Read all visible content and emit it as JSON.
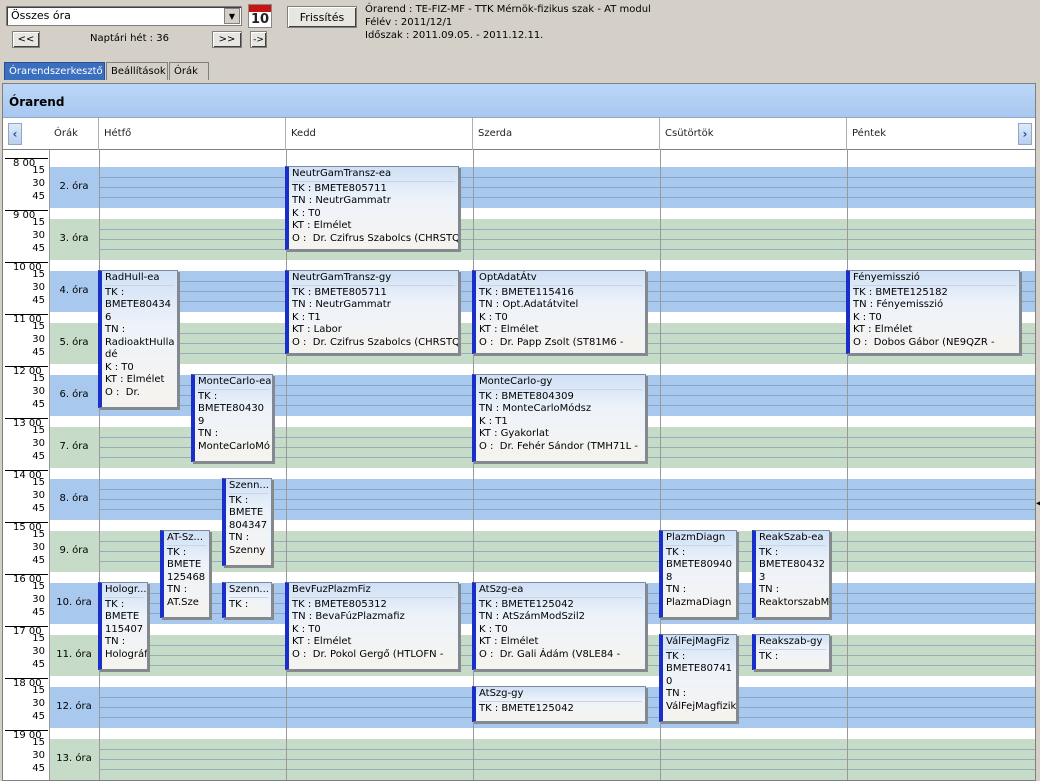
{
  "toolbar": {
    "combo_value": "Összes óra",
    "calendar_day": "10",
    "prev_label": "<<",
    "next_label": ">>",
    "step_label": "->",
    "week_label": "Naptári hét : 36",
    "refresh_label": "Frissítés"
  },
  "info": {
    "line1": "Órarend : TE-FIZ-MF - TTK Mérnök-fizikus szak - AT modul",
    "line2": "Félév : 2011/12/1",
    "line3": "Időszak : 2011.09.05. - 2011.12.11."
  },
  "tabs": [
    "Órarendszerkesztő",
    "Beállítások",
    "Órák"
  ],
  "grid": {
    "title": "Órarend",
    "headers": [
      "Órák",
      "Hétfő",
      "Kedd",
      "Szerda",
      "Csütörtök",
      "Péntek"
    ],
    "hours": [
      "8 00",
      "9 00",
      "10 00",
      "11 00",
      "12 00",
      "13 00",
      "14 00",
      "15 00",
      "16 00",
      "17 00",
      "18 00",
      "19 00"
    ],
    "quarters": [
      "15",
      "30",
      "45"
    ],
    "periods": [
      "2. óra",
      "3. óra",
      "4. óra",
      "5. óra",
      "6. óra",
      "7. óra",
      "8. óra",
      "9. óra",
      "10. óra",
      "11. óra",
      "12. óra",
      "13. óra"
    ]
  },
  "events": [
    {
      "lines": [
        "NeutrGamTransz-ea",
        "TK : BMETE805711",
        "TN : NeutrGammatr",
        "K : T0",
        "KT : Elmélet",
        "O :  Dr. Czifrus Szabolcs (CHRSTQ"
      ]
    },
    {
      "lines": [
        "RadHull-ea",
        "TK :",
        "BMETE80434",
        "6",
        "TN :",
        "RadioaktHulla",
        "dé",
        "K : T0",
        "KT : Elmélet",
        "O :  Dr."
      ]
    },
    {
      "lines": [
        "NeutrGamTransz-gy",
        "TK : BMETE805711",
        "TN : NeutrGammatr",
        "K : T1",
        "KT : Labor",
        "O :  Dr. Czifrus Szabolcs (CHRSTQ"
      ]
    },
    {
      "lines": [
        "OptAdatÁtv",
        "TK : BMETE115416",
        "TN : Opt.Adatátvitel",
        "K : T0",
        "KT : Elmélet",
        "O :  Dr. Papp Zsolt (ST81M6 -"
      ]
    },
    {
      "lines": [
        "Fényemisszió",
        "TK : BMETE125182",
        "TN : Fényemisszió",
        "K : T0",
        "KT : Elmélet",
        "O :  Dobos Gábor (NE9QZR -"
      ]
    },
    {
      "lines": [
        "MonteCarlo-ea",
        "TK :",
        "BMETE80430",
        "9",
        "TN :",
        "MonteCarloMó"
      ]
    },
    {
      "lines": [
        "MonteCarlo-gy",
        "TK : BMETE804309",
        "TN : MonteCarloMódsz",
        "K : T1",
        "KT : Gyakorlat",
        "O :  Dr. Fehér Sándor (TMH71L -"
      ]
    },
    {
      "lines": [
        "Szenn...",
        "TK :",
        "BMETE",
        "804347",
        "TN :",
        "Szenny"
      ]
    },
    {
      "lines": [
        "AT-Sz...",
        "TK :",
        "BMETE",
        "125468",
        "TN :",
        "AT.Sze"
      ]
    },
    {
      "lines": [
        "PlazmDiagn",
        "TK :",
        "BMETE80940",
        "8",
        "TN :",
        "PlazmaDiagn"
      ]
    },
    {
      "lines": [
        "ReakSzab-ea",
        "TK :",
        "BMETE80432",
        "3",
        "TN :",
        "ReaktorszabM"
      ]
    },
    {
      "lines": [
        "Hologr...",
        "TK :",
        "BMETE",
        "115407",
        "TN :",
        "Holográf"
      ]
    },
    {
      "lines": [
        "Szenn...",
        "TK :"
      ]
    },
    {
      "lines": [
        "BevFuzPlazmFiz",
        "TK : BMETE805312",
        "TN : BevaFúzPlazmafiz",
        "K : T0",
        "KT : Elmélet",
        "O :  Dr. Pokol Gergő (HTLOFN -"
      ]
    },
    {
      "lines": [
        "AtSzg-ea",
        "TK : BMETE125042",
        "TN : AtSzámModSzil2",
        "K : T0",
        "KT : Elmélet",
        "O :  Dr. Gali Ádám (V8LE84 -"
      ]
    },
    {
      "lines": [
        "VálFejMagFiz",
        "TK :",
        "BMETE80741",
        "0",
        "TN :",
        "VálFejMagfizik"
      ]
    },
    {
      "lines": [
        "Reakszab-gy",
        "TK :"
      ]
    },
    {
      "lines": [
        "AtSzg-gy",
        "TK : BMETE125042"
      ]
    }
  ]
}
